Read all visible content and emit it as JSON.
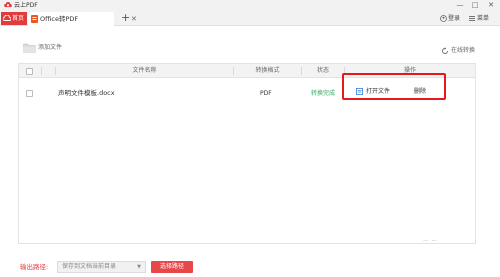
{
  "app": {
    "title": "云上PDF",
    "logo_icon": "cloud-pdf-logo",
    "accent_color": "#e23b3b",
    "window_controls": {
      "minimize": "—",
      "maximize": "□",
      "close": "✕"
    }
  },
  "tabs": {
    "home_label": "首页",
    "active_label": "Office转PDF",
    "close_symbol": "✕",
    "add_symbol": "+"
  },
  "header": {
    "login_label": "登录",
    "menu_label": "菜单"
  },
  "toolbar": {
    "add_file_label": "添加文件",
    "online_convert_label": "在线转换"
  },
  "table": {
    "columns": {
      "filename": "文件名称",
      "format": "转换格式",
      "status": "状态",
      "action": "操作"
    },
    "rows": [
      {
        "filename": "声明文件模板.docx",
        "format": "PDF",
        "status": "转换完成",
        "open_label": "打开文件",
        "delete_label": "删除"
      }
    ],
    "status_color": "#3aa660"
  },
  "footer": {
    "output_label": "输出路径:",
    "output_select_value": "保存到文档当前目录",
    "select_caret": "▼",
    "choose_path_label": "选择路径"
  }
}
